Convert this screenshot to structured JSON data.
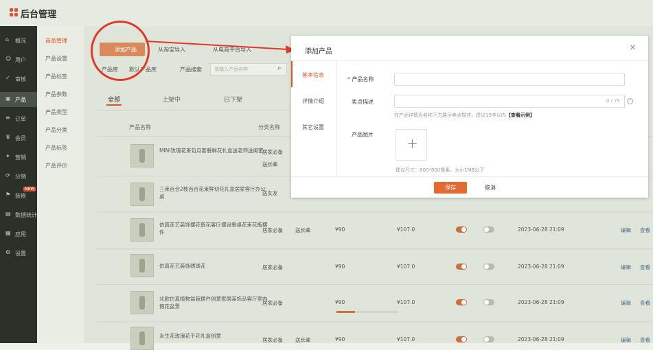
{
  "app": {
    "title": "后台管理"
  },
  "sidebar": {
    "items": [
      {
        "label": "概况",
        "icon": "home-icon"
      },
      {
        "label": "用户",
        "icon": "user-icon"
      },
      {
        "label": "审核",
        "icon": "check-icon"
      },
      {
        "label": "产品",
        "icon": "box-icon",
        "active": true
      },
      {
        "label": "订单",
        "icon": "order-icon"
      },
      {
        "label": "会员",
        "icon": "crown-icon"
      },
      {
        "label": "营销",
        "icon": "gift-icon"
      },
      {
        "label": "分销",
        "icon": "share-icon"
      },
      {
        "label": "装修",
        "icon": "flag-icon",
        "badge": "NEW"
      },
      {
        "label": "数据统计",
        "icon": "chart-icon"
      },
      {
        "label": "应用",
        "icon": "grid-icon"
      },
      {
        "label": "设置",
        "icon": "gear-icon"
      }
    ]
  },
  "subnav": {
    "items": [
      {
        "label": "商品管理",
        "active": true
      },
      {
        "label": "产品设置"
      },
      {
        "label": "产品标签"
      },
      {
        "label": "产品参数"
      },
      {
        "label": "产品类型"
      },
      {
        "label": "产品分类"
      },
      {
        "label": "产品标签"
      },
      {
        "label": "产品评价"
      }
    ]
  },
  "toolbar": {
    "add_label": "添加产品",
    "import1": "从淘宝导入",
    "import2": "从电商平台导入",
    "filter1": "产品库",
    "filter2": "默认产品库",
    "search_label": "产品搜索",
    "search_placeholder": "请输入产品名称"
  },
  "tabs": [
    "全部",
    "上架中",
    "已下架"
  ],
  "table": {
    "headers": [
      "产品名称",
      "分类名称"
    ],
    "rows": [
      {
        "name": "MINI玫瑰花束包月套餐鲜花礼盒送老师送闺蜜",
        "cat1": "居家必备",
        "cat2": "送长辈",
        "price": "",
        "price2": "",
        "date": ""
      },
      {
        "name": "三束百合2枝百合花束鲜切花礼盒居家客厅办公桌",
        "cat1": "送女友",
        "cat2": "",
        "price": "",
        "price2": "",
        "date": ""
      },
      {
        "name": "仿真花艺装饰摆花假花客厅摆设餐桌花束花瓶摆件",
        "cat1": "居家必备",
        "cat2": "送长辈",
        "price": "¥90",
        "price2": "¥107.0",
        "date": "2023-06-28 21:09"
      },
      {
        "name": "仿真花艺装饰绣球花",
        "cat1": "居家必备",
        "cat2": "",
        "price": "¥90",
        "price2": "¥107.0",
        "date": "2023-06-28 21:09"
      },
      {
        "name": "北欧仿真植物盆栽摆件创意家居装饰品客厅室内假花盆景",
        "cat1": "居家必备",
        "cat2": "",
        "price": "¥90",
        "price2": "¥107.0",
        "date": "2023-06-28 21:09"
      },
      {
        "name": "永生花玫瑰花干花礼盒创意",
        "cat1": "居家必备",
        "cat2": "送长辈",
        "price": "¥90",
        "price2": "¥107.0",
        "date": "2023-06-28 21:09"
      }
    ],
    "actions": [
      "编辑",
      "查看"
    ]
  },
  "progress": {
    "value": 0.3
  },
  "modal": {
    "title": "添加产品",
    "tabs": [
      "基本信息",
      "详情介绍",
      "其它设置"
    ],
    "name_label": "产品名称",
    "selling_label": "卖点描述",
    "selling_count": "0 / 75",
    "selling_hint": "在产品详情页名称下方展示卖点描述，建议15字以内",
    "example_link": "【查看示例】",
    "image_label": "产品图片",
    "image_hint": "建议尺寸：800*800像素，大小1MB以下",
    "save": "保存",
    "cancel": "取消"
  },
  "colors": {
    "accent": "#e36b32",
    "annotation": "#e0392a"
  }
}
